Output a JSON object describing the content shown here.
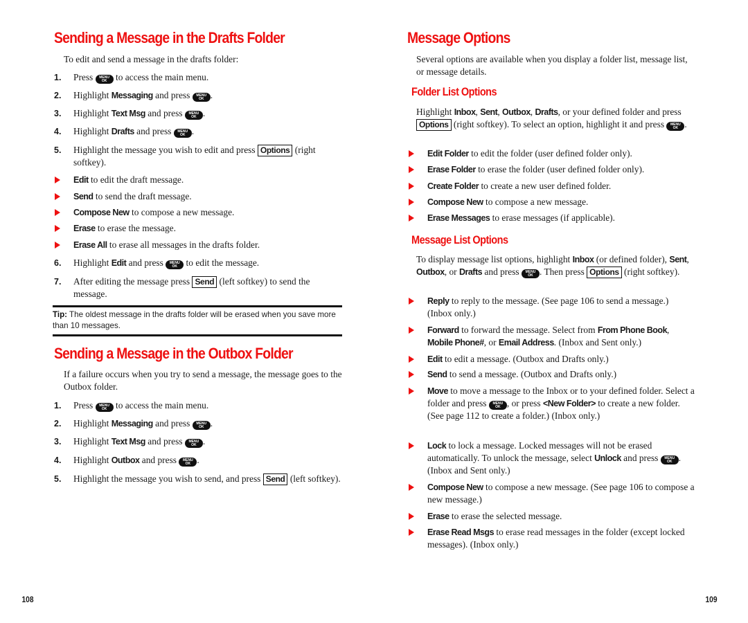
{
  "key_icons": {
    "menu_ok_top": "MENU",
    "menu_ok_bottom": "OK"
  },
  "left_page": {
    "drafts": {
      "title": "Sending a Message in the Drafts Folder",
      "intro": "To edit and send a message in the drafts folder:",
      "steps": [
        {
          "num": "1.",
          "pre": "Press ",
          "key": "menu-ok",
          "post": " to access the main menu."
        },
        {
          "num": "2.",
          "pre": "Highlight ",
          "bold": "Messaging",
          "mid": " and press ",
          "key": "menu-ok",
          "post": "."
        },
        {
          "num": "3.",
          "pre": "Highlight ",
          "bold": "Text Msg",
          "mid": " and press ",
          "key": "menu-ok",
          "post": "."
        },
        {
          "num": "4.",
          "pre": "Highlight ",
          "bold": "Drafts",
          "mid": " and press ",
          "key": "menu-ok",
          "post": "."
        },
        {
          "num": "5.",
          "pre": "Highlight the message you wish to edit and press ",
          "softkey": "Options",
          "post": " (right softkey)."
        }
      ],
      "options": [
        {
          "bold": "Edit",
          "text": " to edit the draft message."
        },
        {
          "bold": "Send",
          "text": " to send the draft message."
        },
        {
          "bold": "Compose New",
          "text": " to compose a new message."
        },
        {
          "bold": "Erase",
          "text": " to erase the message."
        },
        {
          "bold": "Erase All",
          "text": " to erase all messages in the drafts folder."
        }
      ],
      "steps_after": [
        {
          "num": "6.",
          "pre": "Highlight ",
          "bold": "Edit",
          "mid": " and press ",
          "key": "menu-ok",
          "post": " to edit the message."
        },
        {
          "num": "7.",
          "pre": "After editing the message press ",
          "softkey": "Send",
          "post": " (left softkey) to send the message."
        }
      ],
      "tip_label": "Tip:",
      "tip_text": " The oldest message in the drafts folder will be erased when you save more than 10 messages."
    },
    "outbox": {
      "title": "Sending a Message in the Outbox Folder",
      "intro": "If a failure occurs when you try to send a message, the message goes to the Outbox folder.",
      "steps": [
        {
          "num": "1.",
          "pre": "Press ",
          "key": "menu-ok",
          "post": " to access the main menu."
        },
        {
          "num": "2.",
          "pre": "Highlight ",
          "bold": "Messaging",
          "mid": " and press ",
          "key": "menu-ok",
          "post": "."
        },
        {
          "num": "3.",
          "pre": "Highlight ",
          "bold": "Text Msg",
          "mid": " and press ",
          "key": "menu-ok",
          "post": "."
        },
        {
          "num": "4.",
          "pre": "Highlight ",
          "bold": "Outbox",
          "mid": " and press ",
          "key": "menu-ok",
          "post": "."
        },
        {
          "num": "5.",
          "pre": "Highlight the message you wish to send, and press ",
          "softkey": "Send",
          "post": " (left softkey)."
        }
      ]
    },
    "page_number": "108"
  },
  "right_page": {
    "title": "Message Options",
    "intro": "Several options are available when you display a folder list, message list, or message details.",
    "folder_list": {
      "heading": "Folder List Options",
      "intro_parts": [
        {
          "t": "Highlight "
        },
        {
          "b": "Inbox"
        },
        {
          "t": ", "
        },
        {
          "b": "Sent"
        },
        {
          "t": ", "
        },
        {
          "b": "Outbox"
        },
        {
          "t": ", "
        },
        {
          "b": "Drafts"
        },
        {
          "t": ", or your defined folder and press "
        },
        {
          "s": "Options"
        },
        {
          "t": " (right softkey). To select an option, highlight it and press "
        },
        {
          "k": "menu-ok"
        },
        {
          "t": "."
        }
      ],
      "options": [
        {
          "bold": "Edit Folder",
          "text": " to edit the folder (user defined folder only)."
        },
        {
          "bold": "Erase Folder",
          "text": " to erase the folder (user defined folder only)."
        },
        {
          "bold": "Create Folder",
          "text": " to create a new user defined folder."
        },
        {
          "bold": "Compose New",
          "text": " to compose a new message."
        },
        {
          "bold": "Erase Messages",
          "text": " to erase messages (if applicable)."
        }
      ]
    },
    "message_list": {
      "heading": "Message List Options",
      "intro_parts": [
        {
          "t": "To display message list options, highlight "
        },
        {
          "b": "Inbox"
        },
        {
          "t": " (or defined folder), "
        },
        {
          "b": "Sent"
        },
        {
          "t": ", "
        },
        {
          "b": "Outbox"
        },
        {
          "t": ", or "
        },
        {
          "b": "Drafts"
        },
        {
          "t": " and press "
        },
        {
          "k": "menu-ok"
        },
        {
          "t": ". Then press "
        },
        {
          "s": "Options"
        },
        {
          "t": " (right softkey)."
        }
      ],
      "options": [
        {
          "parts": [
            {
              "b": "Reply"
            },
            {
              "t": " to reply to the message. (See page 106 to send a message.) (Inbox only.)"
            }
          ]
        },
        {
          "parts": [
            {
              "b": "Forward"
            },
            {
              "t": " to forward the message. Select from "
            },
            {
              "b": "From Phone Book"
            },
            {
              "t": ", "
            },
            {
              "b": "Mobile Phone#"
            },
            {
              "t": ", or "
            },
            {
              "b": "Email Address"
            },
            {
              "t": ". (Inbox and Sent only.)"
            }
          ]
        },
        {
          "parts": [
            {
              "b": "Edit"
            },
            {
              "t": " to edit a message. (Outbox and Drafts only.)"
            }
          ]
        },
        {
          "parts": [
            {
              "b": "Send"
            },
            {
              "t": " to send a message. (Outbox and Drafts only.)"
            }
          ]
        },
        {
          "parts": [
            {
              "b": "Move"
            },
            {
              "t": " to move a message to the Inbox or to your defined folder. Select a folder and press "
            },
            {
              "k": "menu-ok"
            },
            {
              "t": ", or press "
            },
            {
              "b": "<New Folder>"
            },
            {
              "t": " to create a new folder. (See page 112 to create a folder.) (Inbox only.)"
            }
          ]
        },
        {
          "parts": [
            {
              "b": "Lock"
            },
            {
              "t": " to lock a message. Locked messages will not be erased automatically. To unlock the message, select "
            },
            {
              "b": "Unlock"
            },
            {
              "t": " and press "
            },
            {
              "k": "menu-ok"
            },
            {
              "t": ". (Inbox and Sent only.)"
            }
          ]
        },
        {
          "parts": [
            {
              "b": "Compose New"
            },
            {
              "t": " to compose a new message. (See page 106 to compose a new message.)"
            }
          ]
        },
        {
          "parts": [
            {
              "b": "Erase"
            },
            {
              "t": " to erase the selected message."
            }
          ]
        },
        {
          "parts": [
            {
              "b": "Erase Read Msgs"
            },
            {
              "t": " to erase read messages in the folder (except locked messages). (Inbox only.)"
            }
          ]
        }
      ]
    },
    "page_number": "109"
  },
  "colors": {
    "heading_red": "#ee1111",
    "text": "#1a1a1a",
    "rule": "#111111"
  }
}
